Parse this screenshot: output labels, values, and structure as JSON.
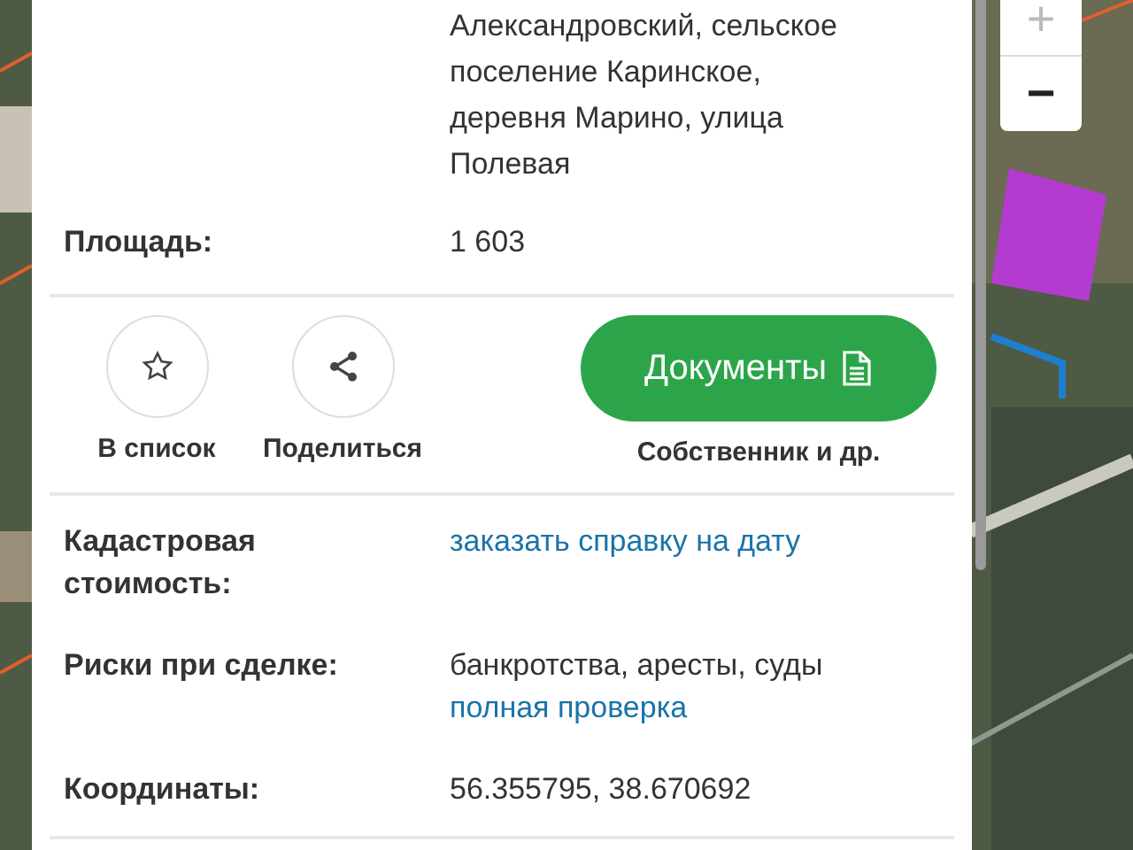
{
  "address": {
    "lines": [
      "Александровский, сельское",
      "поселение Каринское,",
      "деревня Марино, улица",
      "Полевая"
    ]
  },
  "area": {
    "label": "Площадь:",
    "value": "1 603"
  },
  "actions": [
    {
      "kind": "star",
      "label": "В список"
    },
    {
      "kind": "share",
      "label": "Поделиться"
    }
  ],
  "documents": {
    "button": "Документы",
    "caption": "Собственник и др."
  },
  "details": [
    {
      "label": "Кадастровая стоимость:",
      "link": "заказать справку на дату"
    },
    {
      "label": "Риски при сделке:",
      "value": "банкротства, аресты, суды",
      "link": "полная проверка"
    },
    {
      "label": "Координаты:",
      "value": "56.355795, 38.670692"
    }
  ],
  "map_controls": [
    "+",
    "−"
  ]
}
